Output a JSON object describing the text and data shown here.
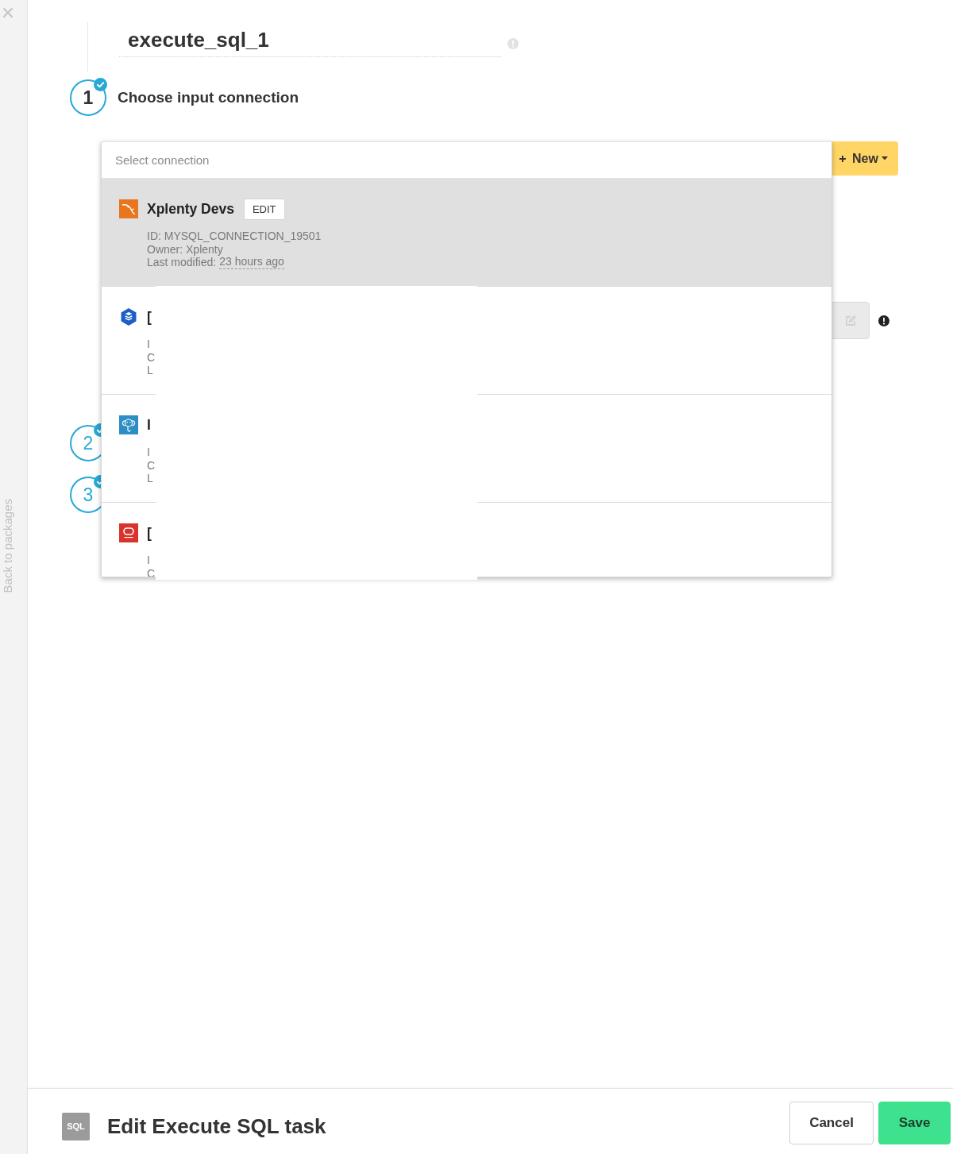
{
  "sidebar": {
    "back_link": "Back to packages"
  },
  "header": {
    "task_name": "execute_sql_1"
  },
  "steps": [
    {
      "number": "1",
      "label": "Choose input connection",
      "active": true,
      "completed": true
    },
    {
      "number": "2",
      "active": false,
      "completed": true
    },
    {
      "number": "3",
      "active": false,
      "completed": true
    }
  ],
  "connection_controls": {
    "new_button": {
      "label": "New"
    },
    "edit_button": {
      "disabled": true
    }
  },
  "connection_dropdown": {
    "placeholder": "Select connection",
    "items": [
      {
        "kind": "mysql",
        "title": "Xplenty Devs",
        "edit_label": "EDIT",
        "selected": true,
        "details": [
          {
            "text": "ID: MYSQL_CONNECTION_19501"
          },
          {
            "text": "Owner: Xplenty"
          },
          {
            "text": "Last modified:",
            "time": "23 hours ago"
          }
        ]
      },
      {
        "kind": "bigquery",
        "title": "[",
        "selected": false,
        "details": [
          {
            "text": "I"
          },
          {
            "text": "C"
          },
          {
            "text": "L"
          }
        ]
      },
      {
        "kind": "postgres",
        "title": "I",
        "selected": false,
        "details": [
          {
            "text": "I"
          },
          {
            "text": "C"
          },
          {
            "text": "L"
          }
        ]
      },
      {
        "kind": "oracle",
        "title": "[",
        "selected": false,
        "details": [
          {
            "text": "I"
          },
          {
            "text": "C"
          }
        ]
      }
    ]
  },
  "footer": {
    "icon_label": "SQL",
    "title": "Edit Execute SQL task",
    "buttons": [
      {
        "label": "Cancel",
        "kind": "secondary"
      },
      {
        "label": "Save",
        "kind": "primary"
      }
    ]
  }
}
